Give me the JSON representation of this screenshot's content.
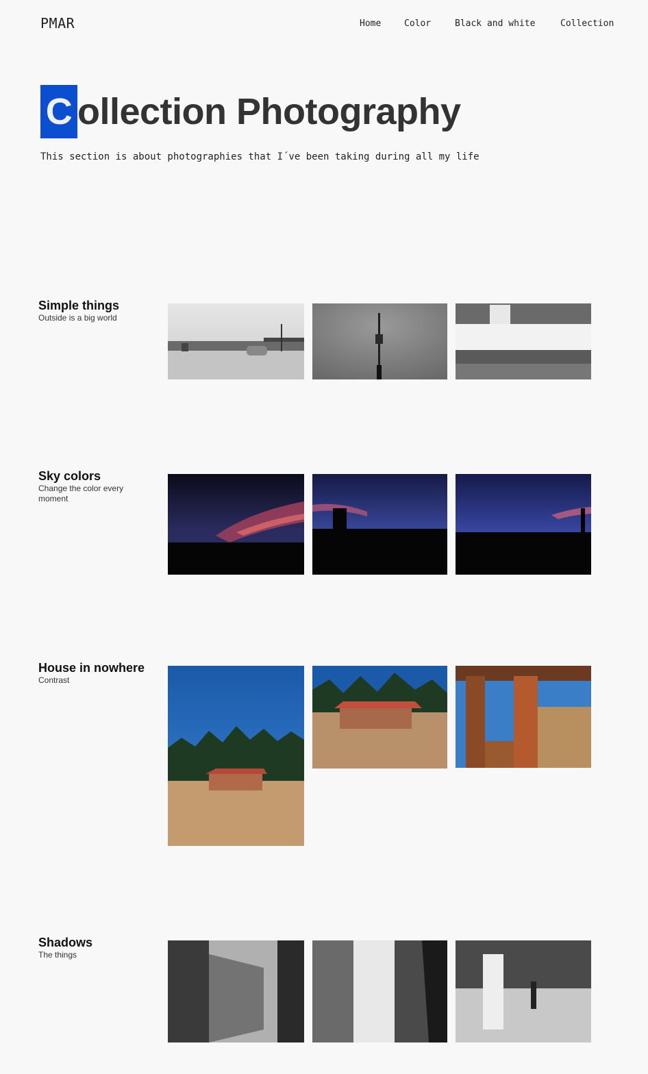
{
  "site": {
    "logo": "PMAR"
  },
  "nav": {
    "items": [
      "Home",
      "Color",
      "Black and white",
      "Collection"
    ]
  },
  "hero": {
    "title_first_letter": "C",
    "title_rest": "ollection Photography",
    "description": "This section is about photographies that I´ve been taking during all my life",
    "accent_color": "#0b4fd0"
  },
  "sections": [
    {
      "title": "Simple things",
      "subtitle": "Outside is a big world"
    },
    {
      "title": "Sky colors",
      "subtitle": "Change the color every moment"
    },
    {
      "title": "House in nowhere",
      "subtitle": "Contrast"
    },
    {
      "title": "Shadows",
      "subtitle": "The things"
    }
  ]
}
